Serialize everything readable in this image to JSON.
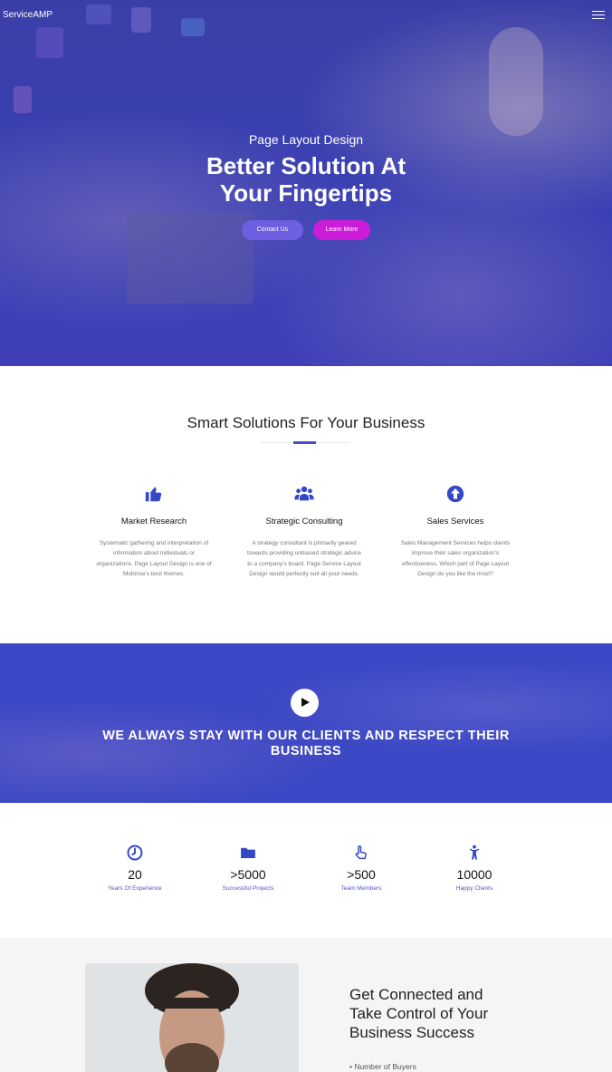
{
  "nav": {
    "brand": "ServiceAMP",
    "menu_icon": "hamburger-icon"
  },
  "hero": {
    "subtitle": "Page Layout Design",
    "title_line1": "Better Solution At",
    "title_line2": "Your Fingertips",
    "contact_button": "Contact Us",
    "learn_button": "Learn More"
  },
  "solutions": {
    "title": "Smart Solutions For Your Business",
    "items": [
      {
        "icon": "thumbs-up-icon",
        "title": "Market Research",
        "text": "Systematic gathering and interpretation of information about individuals or organizations. Page Layout Design is one of Mobirise's best themes."
      },
      {
        "icon": "users-icon",
        "title": "Strategic Consulting",
        "text": "A strategy consultant is primarily geared towards providing unbiased strategic advice to a company's board. Page Service Layout Design would perfectly suit all your needs."
      },
      {
        "icon": "arrow-up-circle-icon",
        "title": "Sales Services",
        "text": "Sales Management Services helps clients improve their sales organization's effectiveness. Which part of Page Layout Design do you like the most?"
      }
    ]
  },
  "video": {
    "play_icon": "play-icon",
    "line1": "WE ALWAYS STAY WITH OUR CLIENTS AND RESPECT THEIR",
    "line2": "BUSINESS"
  },
  "stats": [
    {
      "icon": "clock-icon",
      "value": "20",
      "label": "Years Of Experience"
    },
    {
      "icon": "folder-icon",
      "value": ">5000",
      "label": "Successful Projects"
    },
    {
      "icon": "pointer-hand-icon",
      "value": ">500",
      "label": "Team Members"
    },
    {
      "icon": "person-icon",
      "value": "10000",
      "label": "Happy Clients"
    }
  ],
  "connect": {
    "title_line1": "Get Connected and",
    "title_line2": "Take Control of Your",
    "title_line3": "Business Success",
    "bullet": "• Number of Buyers"
  },
  "colors": {
    "accent": "#4a4ad6",
    "hero_overlay": "#3a3fb4",
    "learn_button": "#cc1cd9",
    "contact_button": "#6c5fe0"
  }
}
